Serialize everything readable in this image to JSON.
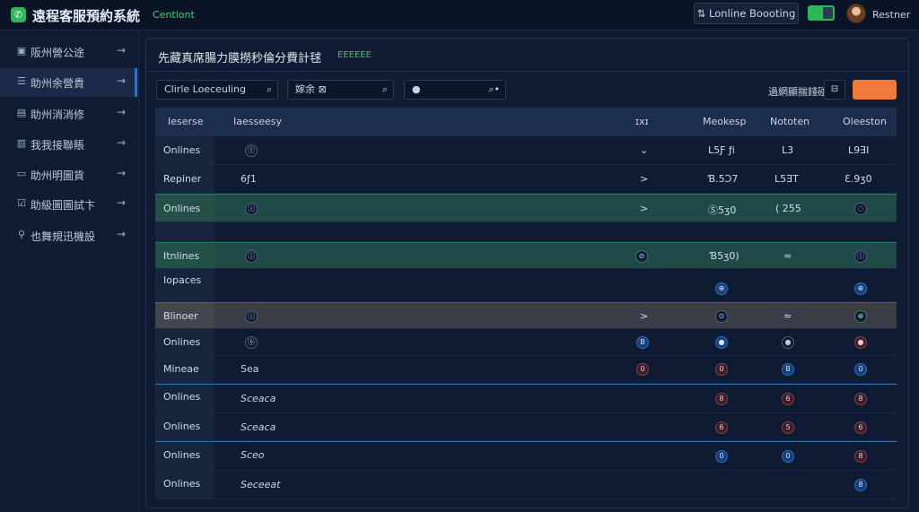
{
  "header": {
    "app_title": "遠程客服預約系統",
    "status": "Centlont",
    "booking_button": "⇅ Lonline Boooting",
    "user_name": "Restner"
  },
  "sidebar": {
    "items": [
      {
        "label": "阪州營公途",
        "icon": "grid-icon",
        "glyph": "▣",
        "active": false
      },
      {
        "label": "助州余營貴",
        "icon": "list-icon",
        "glyph": "☰",
        "active": true
      },
      {
        "label": "助州消消修",
        "icon": "doc-icon",
        "glyph": "▤",
        "active": false
      },
      {
        "label": "我我接聯賬",
        "icon": "chart-icon",
        "glyph": "▥",
        "active": false
      },
      {
        "label": "助州明圖貨",
        "icon": "folder-icon",
        "glyph": "▭",
        "active": false
      },
      {
        "label": "助級圖圖試卞",
        "icon": "check-icon",
        "glyph": "☑",
        "active": false
      },
      {
        "label": "也舞規迅機設",
        "icon": "location-icon",
        "glyph": "⚲",
        "active": false
      }
    ]
  },
  "panel": {
    "title": "先藏真席腸力膜撈秒倫分費計毬",
    "tag": "EEEEEE"
  },
  "toolbar": {
    "search1": "Clirle Loeceuling",
    "search2": "嫁余  ⊠",
    "search3": "●  ",
    "filter_label": "過網顯揣錢碰",
    "filter_icon": "⊟"
  },
  "table": {
    "headers": [
      "Ieserse",
      "Iaesseesy",
      "ɪxɪ",
      "Meokesp",
      "Nototen",
      "Oleeston"
    ],
    "rows": [
      {
        "name": "Onlines",
        "sub": "",
        "c1": "",
        "c2": "",
        "c3": "",
        "c4": "",
        "c5": ""
      },
      {
        "name": "Repiner",
        "sub": "",
        "c1": "",
        "c2": "",
        "c3": "",
        "c4": "",
        "c5": ""
      },
      {
        "name": "Onlines",
        "sub": "",
        "c1": "",
        "c2": "",
        "c3": "",
        "c4": "",
        "c5": ""
      },
      {
        "name": "",
        "sub": "",
        "c1": "",
        "c2": "",
        "c3": "",
        "c4": "",
        "c5": ""
      },
      {
        "name": "Itnlines",
        "sub": "",
        "c1": "",
        "c2": "",
        "c3": "",
        "c4": "",
        "c5": ""
      },
      {
        "name": "Iopaces",
        "sub": "",
        "c1": "",
        "c2": "",
        "c3": "",
        "c4": "",
        "c5": ""
      },
      {
        "name": "Blinoer",
        "sub": "",
        "c1": "",
        "c2": "",
        "c3": "",
        "c4": "",
        "c5": ""
      },
      {
        "name": "Onlines",
        "sub": "",
        "c1": "",
        "c2": "",
        "c3": "",
        "c4": "",
        "c5": ""
      },
      {
        "name": "Mineae",
        "sub": "Sea",
        "c1": "",
        "c2": "",
        "c3": "",
        "c4": "",
        "c5": ""
      },
      {
        "name": "Onlines",
        "sub": "Sceaca",
        "c1": "",
        "c2": "",
        "c3": "",
        "c4": "",
        "c5": ""
      },
      {
        "name": "Onlines",
        "sub": "Sceaca",
        "c1": "",
        "c2": "",
        "c3": "",
        "c4": "",
        "c5": ""
      },
      {
        "name": "Onlines",
        "sub": "Sceo",
        "c1": "",
        "c2": "",
        "c3": "",
        "c4": "",
        "c5": ""
      },
      {
        "name": "Onlines",
        "sub": "Seceeat",
        "c1": "",
        "c2": "",
        "c3": "",
        "c4": "",
        "c5": ""
      }
    ],
    "values": {
      "r1": {
        "c3": "L5Ƒ ƒi",
        "c4": "L3",
        "c5": "L9ƎI"
      },
      "r2": {
        "sub": "6ƒ1",
        "c1": ">",
        "c3": "Ɓ.5Ɔ7",
        "c4": "L5ƎT",
        "c5": "Ɛ.9ʒ0"
      },
      "r3": {
        "c1": ">",
        "c3": "Ⓢ5ʒ0",
        "c4": "( 255"
      },
      "r5": {
        "c3": "Ɓ5ʒ0)"
      }
    },
    "dots": {
      "r1_sub": "Ⓘ",
      "r3_sub": "ⓘ",
      "r5_sub": "ⓘ",
      "r5_c1": "⊘",
      "r5_c5": "ⓘ",
      "r6_c3": "⊕",
      "r6_c5": "⊕",
      "r7_sub": "ⓘ",
      "r7_c1": ">",
      "r7_c3": "⊙",
      "r7_c4": "≈",
      "r7_c5": "⊕",
      "r8_sub": "ⓑ",
      "r8_c2": "B",
      "r8_c3": "●",
      "r8_c4": "●",
      "r8_c5": "●",
      "r9_c2": "0",
      "r9_c3": "0",
      "r9_c4": "B",
      "r9_c5": "0",
      "r10_c3": "8",
      "r10_c4": "6",
      "r10_c5": "8",
      "r11_c3": "6",
      "r11_c4": "5",
      "r11_c5": "6",
      "r12_c3": "0",
      "r12_c4": "0",
      "r12_c5": "8",
      "r13_c5": "8"
    }
  }
}
